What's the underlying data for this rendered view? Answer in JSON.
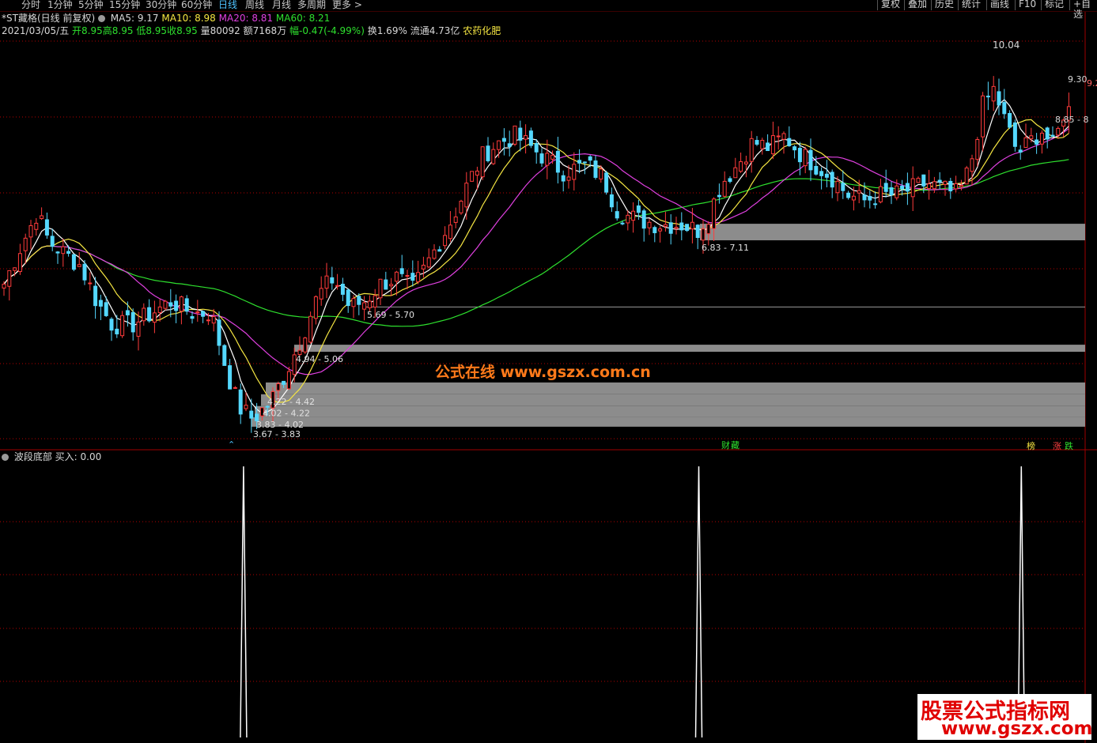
{
  "toolbar": {
    "tabs": [
      "分时",
      "1分钟",
      "5分钟",
      "15分钟",
      "30分钟",
      "60分钟",
      "日线",
      "周线",
      "月线",
      "多周期",
      "更多 >"
    ],
    "active_tab": "日线",
    "right_buttons": [
      "复权",
      "叠加",
      "历史",
      "统计",
      "画线",
      "F10",
      "标记",
      "+自选"
    ]
  },
  "header": {
    "stock": "*ST藏格(日线 前复权)",
    "ma5": "MA5: 9.17",
    "ma10": "MA10: 8.98",
    "ma20": "MA20: 8.81",
    "ma60": "MA60: 8.21"
  },
  "quote": {
    "date": "2021/03/05/五",
    "open": "开8.95",
    "high": "高8.95",
    "low": "低8.95",
    "close": "收8.95",
    "volume": "量80092",
    "amount": "额7168万",
    "change": "幅-0.47(-4.99%)",
    "turnover": "换1.69%",
    "float": "流通4.73亿",
    "industry": "农药化肥"
  },
  "watermark": "公式在线  www.gszx.com.cn",
  "logo": {
    "line1": "股票公式指标网",
    "line2": "www.gszx.com"
  },
  "sub_indicator": {
    "name": "波段底部",
    "value": "买入: 0.00"
  },
  "markers": {
    "cai": "财",
    "cang": "藏",
    "bang": "榜",
    "zhang": "涨",
    "die": "跌",
    "arrow": "⌃"
  },
  "colors": {
    "up": "#ff3b3b",
    "down": "#54d8ff",
    "ma5": "#ffffff",
    "ma10": "#f5e642",
    "ma20": "#e040e0",
    "ma60": "#2ee02e",
    "zone": "#8c8c8c",
    "dotted": "#b40000"
  },
  "chart_data": {
    "type": "candlestick",
    "price_labels": {
      "high_mark": "10.04",
      "right_last": "9.30",
      "right_axis_top": "9.2",
      "right_range": "8.85 - 8"
    },
    "support_zones": [
      {
        "label": "6.83 - 7.11",
        "low": 6.83,
        "high": 7.11
      },
      {
        "label": "5.69 - 5.70",
        "low": 5.69,
        "high": 5.7
      },
      {
        "label": "4.94 - 5.06",
        "low": 4.94,
        "high": 5.06
      },
      {
        "label": "4.22 - 4.42",
        "low": 4.22,
        "high": 4.42
      },
      {
        "label": "4.02 - 4.22",
        "low": 4.02,
        "high": 4.22
      },
      {
        "label": "3.83 - 4.02",
        "low": 3.83,
        "high": 4.02
      },
      {
        "label": "3.67 - 3.83",
        "low": 3.67,
        "high": 3.83
      }
    ],
    "signal_positions": [
      0.222,
      0.637,
      0.931
    ],
    "price_range": [
      3.4,
      10.3
    ]
  }
}
